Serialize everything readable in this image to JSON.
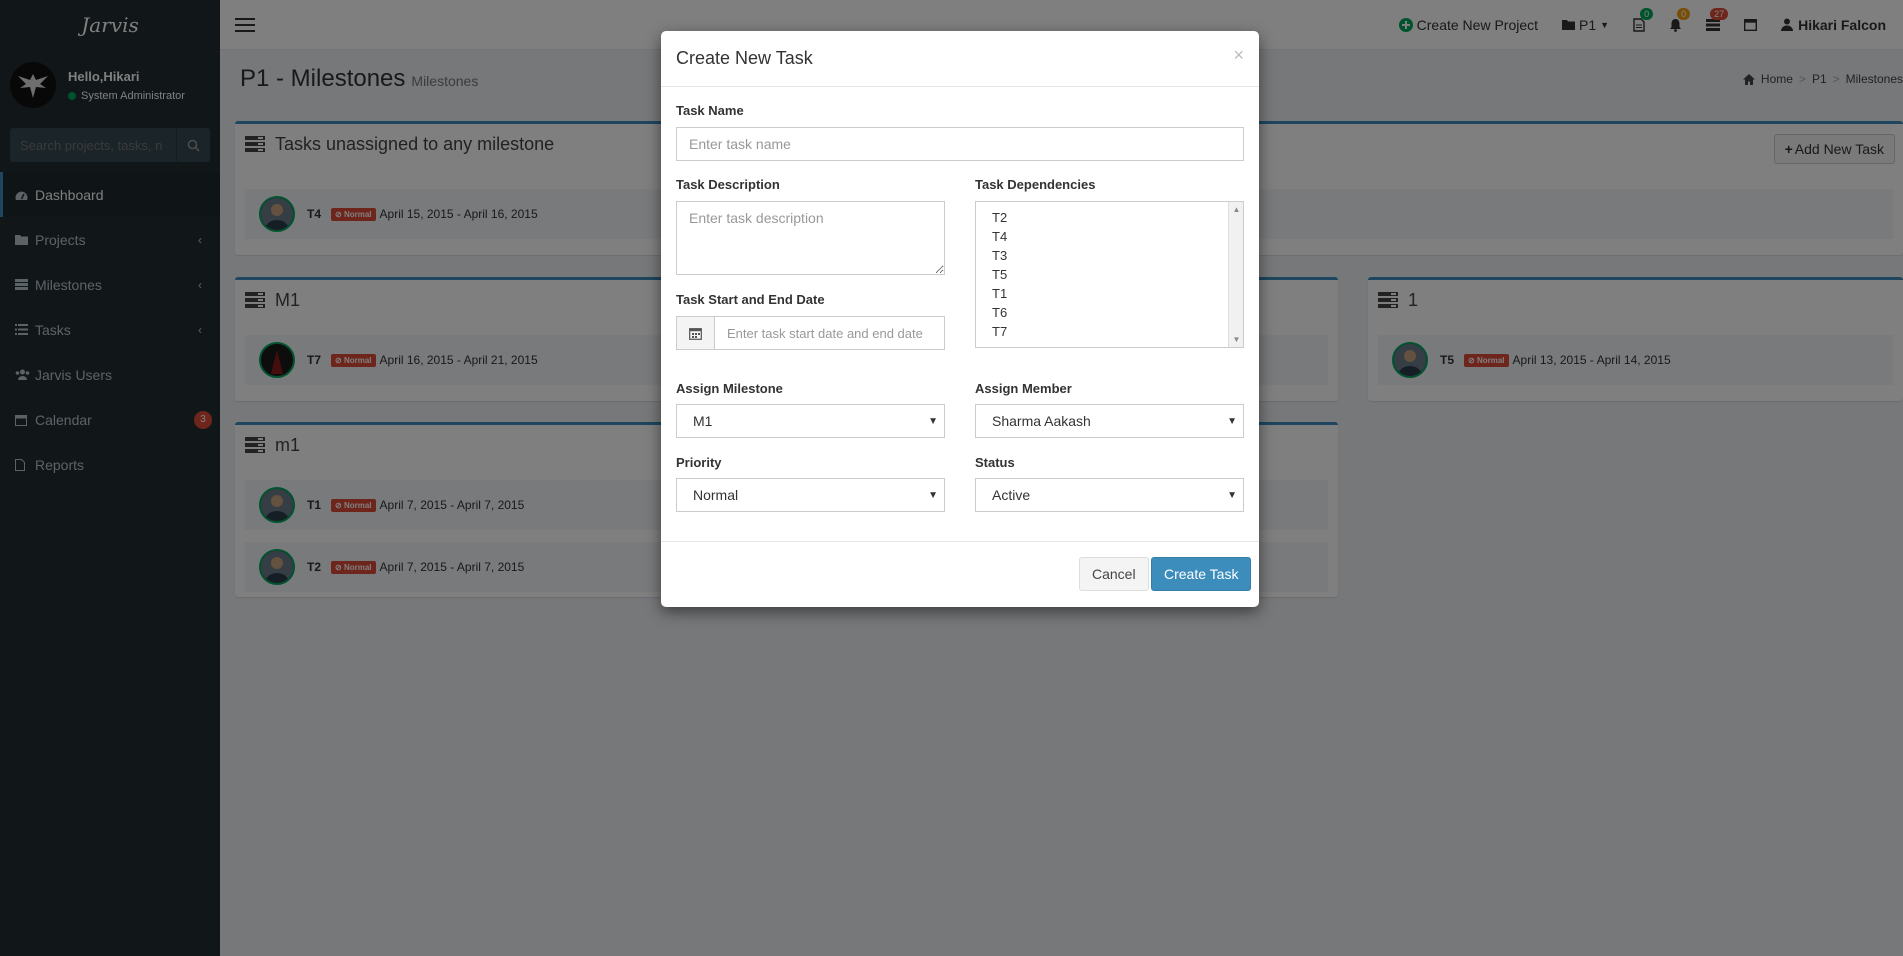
{
  "app": {
    "brand": "Jarvis"
  },
  "user_panel": {
    "greeting": "Hello,Hikari",
    "role": "System Administrator"
  },
  "search": {
    "placeholder": "Search projects, tasks, n"
  },
  "sidebar": {
    "items": [
      {
        "label": "Dashboard",
        "icon": "dashboard-icon"
      },
      {
        "label": "Projects",
        "icon": "folder-icon"
      },
      {
        "label": "Milestones",
        "icon": "milestones-icon"
      },
      {
        "label": "Tasks",
        "icon": "list-icon"
      },
      {
        "label": "Jarvis Users",
        "icon": "users-icon"
      },
      {
        "label": "Calendar",
        "icon": "calendar-icon",
        "badge": "3"
      },
      {
        "label": "Reports",
        "icon": "file-icon"
      }
    ]
  },
  "header": {
    "create_project": "Create New Project",
    "project_dropdown": "P1",
    "docs_badge": "0",
    "notif_badge": "0",
    "tasks_badge": "27",
    "username": "Hikari Falcon"
  },
  "page": {
    "title": "P1 - Milestones",
    "subtitle": "Milestones",
    "breadcrumb": [
      "Home",
      "P1",
      "Milestones"
    ],
    "add_task_label": "Add New Task"
  },
  "boxes": {
    "unassigned": {
      "title": "Tasks unassigned to any milestone",
      "tasks": [
        {
          "name": "T4",
          "priority": "Normal",
          "dates": "April 15, 2015 - April 16, 2015"
        }
      ]
    },
    "m1_upper": {
      "title": "M1",
      "tasks": [
        {
          "name": "T7",
          "priority": "Normal",
          "dates": "April 16, 2015 - April 21, 2015"
        }
      ]
    },
    "one": {
      "title": "1",
      "tasks": [
        {
          "name": "T5",
          "priority": "Normal",
          "dates": "April 13, 2015 - April 14, 2015"
        }
      ]
    },
    "m1_lower": {
      "title": "m1",
      "tasks": [
        {
          "name": "T1",
          "priority": "Normal",
          "dates": "April 7, 2015 - April 7, 2015"
        },
        {
          "name": "T2",
          "priority": "Normal",
          "dates": "April 7, 2015 - April 7, 2015"
        }
      ]
    }
  },
  "modal": {
    "title": "Create New Task",
    "close": "×",
    "task_name_label": "Task Name",
    "task_name_placeholder": "Enter task name",
    "desc_label": "Task Description",
    "desc_placeholder": "Enter task description",
    "deps_label": "Task Dependencies",
    "deps": [
      "T2",
      "T4",
      "T3",
      "T5",
      "T1",
      "T6",
      "T7"
    ],
    "date_label": "Task Start and End Date",
    "date_placeholder": "Enter task start date and end date",
    "milestone_label": "Assign Milestone",
    "milestone_value": "M1",
    "member_label": "Assign Member",
    "member_value": "Sharma Aakash",
    "priority_label": "Priority",
    "priority_value": "Normal",
    "status_label": "Status",
    "status_value": "Active",
    "cancel": "Cancel",
    "submit": "Create Task"
  },
  "colors": {
    "primary": "#3c8dbc",
    "sidebar": "#222d32",
    "danger": "#dd4b39",
    "success": "#00a65a",
    "warning": "#f39c12"
  }
}
